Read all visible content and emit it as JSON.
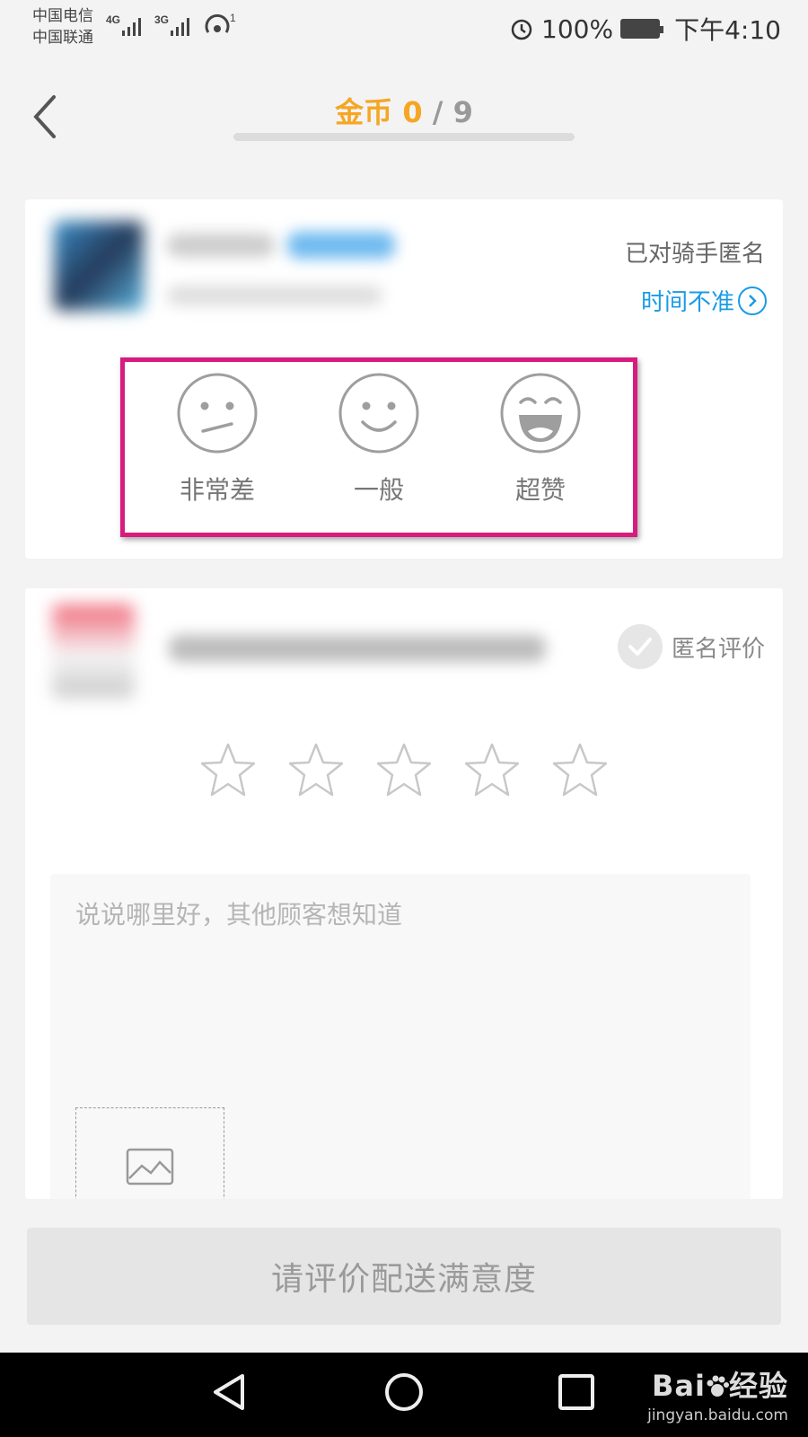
{
  "status_bar": {
    "carrier1": "中国电信",
    "carrier2": "中国联通",
    "net1": "4G",
    "net2": "3G",
    "hotspot_count": "1",
    "battery": "100%",
    "time": "下午4:10"
  },
  "header": {
    "coins_label": "金币",
    "coins_current": "0",
    "coins_separator": "/",
    "coins_total": "9",
    "coins_progress": 0
  },
  "delivery_card": {
    "rider_anonymous_text": "已对骑手匿名",
    "time_inaccurate_link": "时间不准",
    "ratings": [
      {
        "label": "非常差",
        "icon": "neutral-face-icon"
      },
      {
        "label": "一般",
        "icon": "smile-face-icon"
      },
      {
        "label": "超赞",
        "icon": "laugh-face-icon"
      }
    ],
    "highlight_color": "#d81b7f"
  },
  "shop_card": {
    "anonymous_review_label": "匿名评价",
    "star_count": 5,
    "stars_selected": 0,
    "comment_placeholder": "说说哪里好，其他顾客想知道",
    "photo_icon": "image-icon"
  },
  "submit": {
    "label": "请评价配送满意度"
  },
  "watermark": {
    "brand": "Bai",
    "brand_suffix": "经验",
    "url": "jingyan.baidu.com"
  },
  "colors": {
    "accent_orange": "#f5a623",
    "link_blue": "#1a9be6",
    "background": "#f3f3f3"
  }
}
